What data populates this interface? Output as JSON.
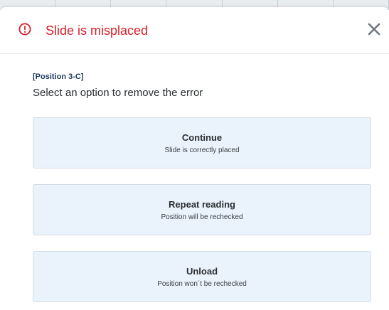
{
  "dialog": {
    "title": "Slide is misplaced",
    "error_icon": "exclamation-circle-icon",
    "close_icon": "close-icon",
    "accent_color": "#d8202a"
  },
  "body": {
    "position_label": "[Position 3-C]",
    "prompt": "Select an option to remove the error"
  },
  "options": [
    {
      "title": "Continue",
      "subtitle": "Slide is correctly placed"
    },
    {
      "title": "Repeat reading",
      "subtitle": "Position will be rechecked"
    },
    {
      "title": "Unload",
      "subtitle": "Position won´t be rechecked"
    }
  ]
}
